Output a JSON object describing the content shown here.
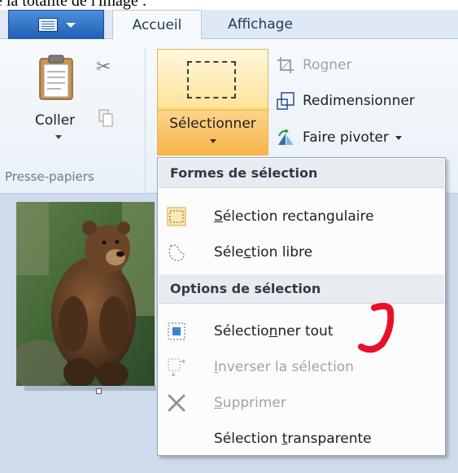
{
  "caption": "e la totalité de l'image :",
  "tabs": {
    "app_menu": "application-menu",
    "home": "Accueil",
    "view": "Affichage"
  },
  "ribbon": {
    "paste": {
      "label": "Coller",
      "icon": "clipboard-icon"
    },
    "cut_icon": "scissors-icon",
    "copy_icon": "copy-icon",
    "clipboard_group": "Presse-papiers",
    "select": {
      "label": "Sélectionner",
      "icon": "rectangle-selection-icon"
    },
    "image_commands": [
      {
        "label": "Rogner",
        "icon": "crop-icon",
        "enabled": false
      },
      {
        "label": "Redimensionner",
        "icon": "resize-icon",
        "enabled": true
      },
      {
        "label": "Faire pivoter",
        "icon": "rotate-icon",
        "enabled": true
      }
    ]
  },
  "menu": {
    "shapes_header": "Formes de sélection",
    "shapes": [
      {
        "pre": "",
        "u": "S",
        "post": "élection rectangulaire",
        "icon": "rectangle-selection-icon"
      },
      {
        "pre": "Séle",
        "u": "c",
        "post": "tion libre",
        "icon": "free-form-selection-icon"
      }
    ],
    "options_header": "Options de sélection",
    "options": [
      {
        "pre": "Sélectio",
        "u": "n",
        "post": "ner tout",
        "icon": "select-all-icon",
        "enabled": true
      },
      {
        "pre": "",
        "u": "I",
        "post": "nverser la sélection",
        "icon": "invert-selection-icon",
        "enabled": false
      },
      {
        "pre": "",
        "u": "S",
        "post": "upprimer",
        "icon": "delete-icon",
        "enabled": false
      },
      {
        "pre": "Sélection ",
        "u": "t",
        "post": "ransparente",
        "icon": "",
        "enabled": true
      }
    ]
  },
  "colors": {
    "accent": "#1d5fb8",
    "selected_button": "#fcc256",
    "annotation": "#e8102a"
  }
}
